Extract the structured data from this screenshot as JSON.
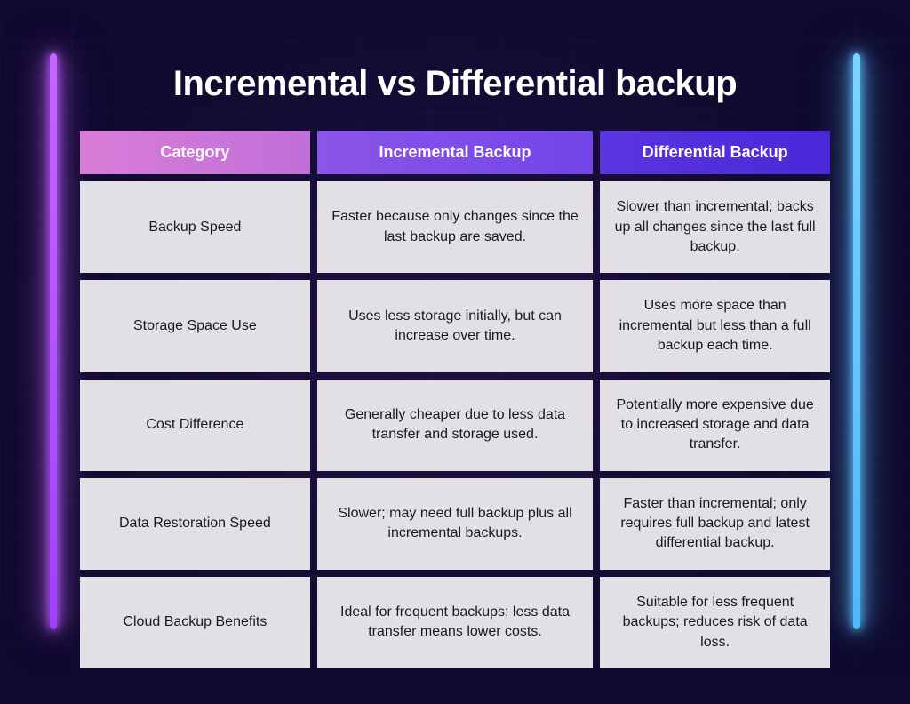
{
  "title": "Incremental vs Differential backup",
  "headers": {
    "category": "Category",
    "incremental": "Incremental Backup",
    "differential": "Differential Backup"
  },
  "rows": [
    {
      "category": "Backup Speed",
      "incremental": "Faster because only changes since the last backup are saved.",
      "differential": "Slower than incremental; backs up all changes since the last full backup."
    },
    {
      "category": "Storage Space Use",
      "incremental": "Uses less storage initially, but can increase over time.",
      "differential": "Uses more space than incremental but less than a full backup each time."
    },
    {
      "category": "Cost Difference",
      "incremental": "Generally cheaper due to less data transfer and storage used.",
      "differential": "Potentially more expensive due to increased storage and data transfer."
    },
    {
      "category": "Data Restoration Speed",
      "incremental": "Slower; may need full backup plus all incremental backups.",
      "differential": "Faster than incremental; only requires full backup and latest differential backup."
    },
    {
      "category": "Cloud Backup Benefits",
      "incremental": "Ideal for frequent backups; less data transfer means lower costs.",
      "differential": "Suitable for less frequent backups; reduces risk of data loss."
    }
  ]
}
